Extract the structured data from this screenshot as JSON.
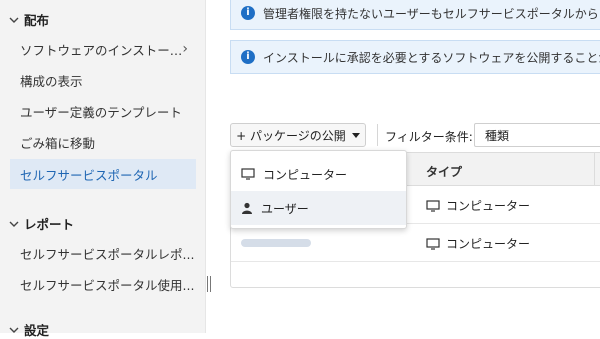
{
  "sidebar": {
    "sections": [
      {
        "title": "配布"
      },
      {
        "title": "レポート"
      },
      {
        "title": "設定"
      }
    ],
    "distribution_items": [
      {
        "label": "ソフトウェアのインストー…",
        "has_arrow": true
      },
      {
        "label": "構成の表示"
      },
      {
        "label": "ユーザー定義のテンプレート"
      },
      {
        "label": "ごみ箱に移動"
      },
      {
        "label": "セルフサービスポータル",
        "active": true
      }
    ],
    "report_items": [
      {
        "label": "セルフサービスポータルレポ..."
      },
      {
        "label": "セルフサービスポータル使用..."
      }
    ]
  },
  "banners": [
    {
      "text": "管理者権限を持たないユーザーもセルフサービスポータルからソフ"
    },
    {
      "text": "インストールに承認を必要とするソフトウェアを公開することがで"
    }
  ],
  "toolbar": {
    "publish_label": "+ パッケージの公開",
    "filter_label": "フィルター条件:",
    "filter_value": "種類"
  },
  "dropdown": {
    "items": [
      {
        "label": "コンピューター",
        "icon": "monitor-icon"
      },
      {
        "label": "ユーザー",
        "icon": "user-icon"
      }
    ]
  },
  "grid": {
    "columns": {
      "type": "タイプ"
    },
    "rows": [
      {
        "type": "コンピューター"
      },
      {
        "type": "コンピューター"
      }
    ]
  },
  "colors": {
    "accent": "#1f66b3",
    "active_bg": "#dfe9f5",
    "info_icon": "#1f6fc5"
  }
}
